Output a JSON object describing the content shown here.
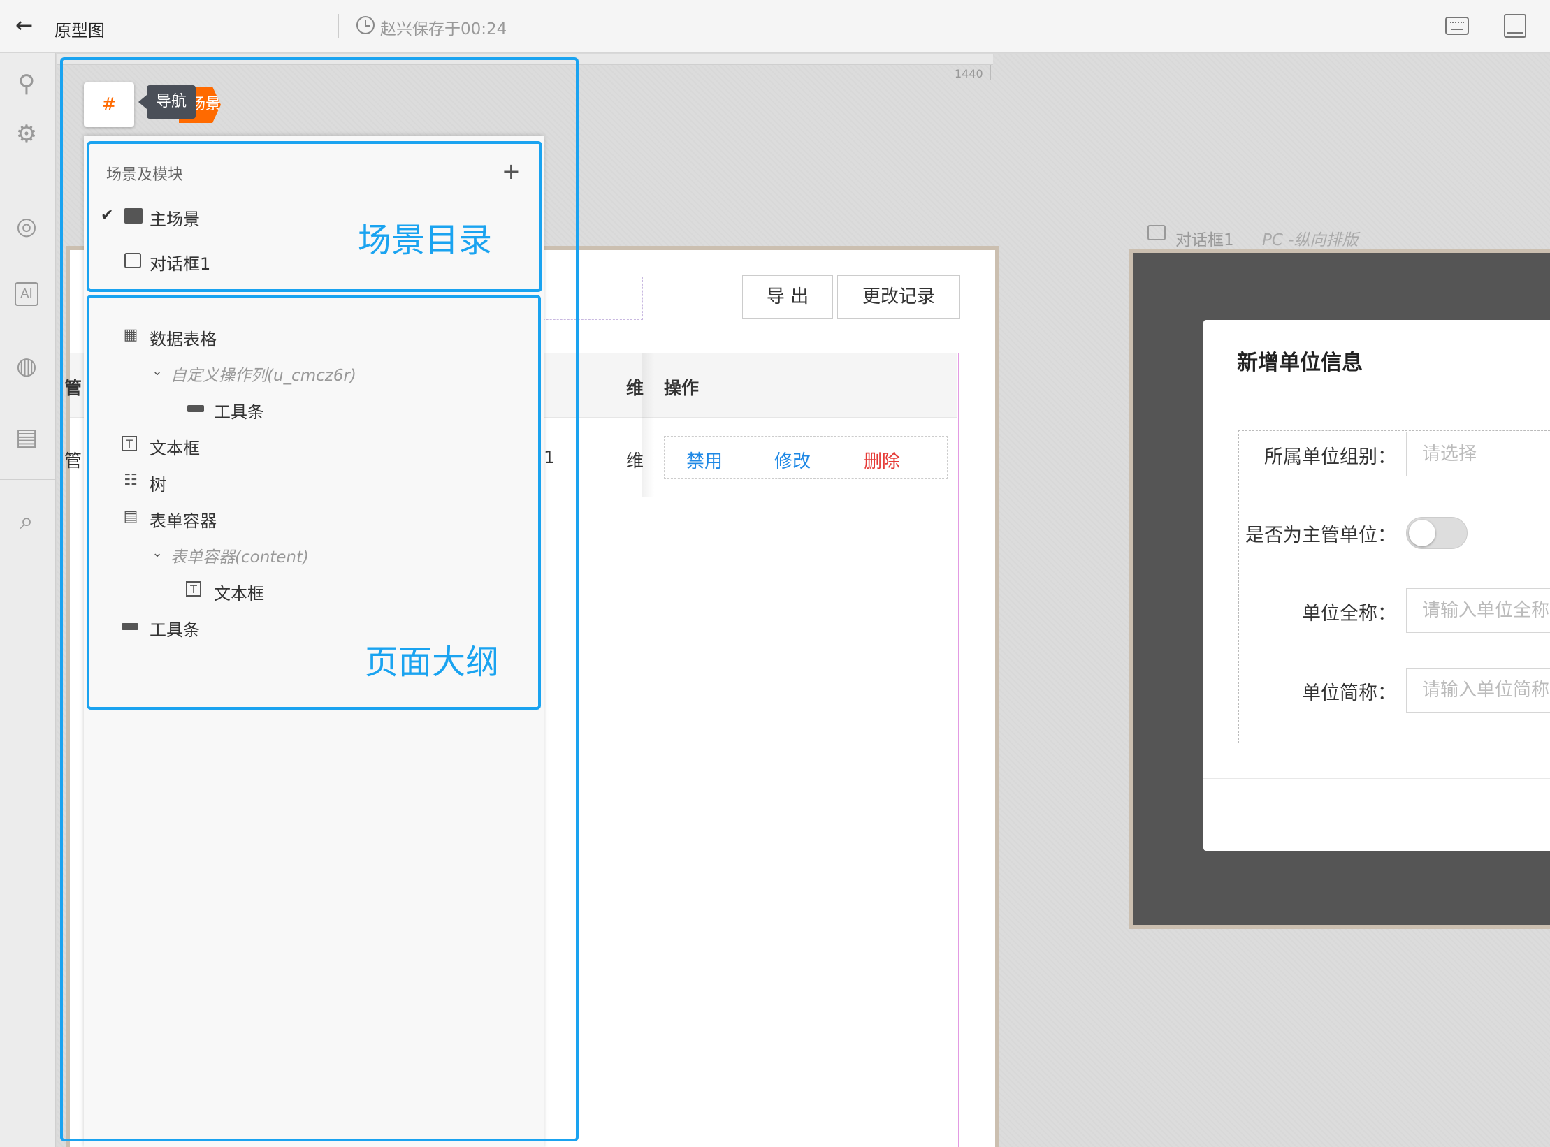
{
  "topbar": {
    "title": "原型图",
    "save_status": "赵兴保存于00:24"
  },
  "ruler": {
    "label": "1440"
  },
  "table": {
    "export_label": "导 出",
    "history_label": "更改记录",
    "header_cut_left": "管",
    "header_cut_mid": "",
    "header_maint": "维",
    "header_action": "操作",
    "row_cut_left": "管",
    "row_cut_mid": "1",
    "row_maint": "维",
    "actions": {
      "disable": "禁用",
      "edit": "修改",
      "delete": "删除"
    }
  },
  "dialog_scene": {
    "name": "对话框1",
    "layout": "PC -纵向排版",
    "title": "新增单位信息",
    "fields": {
      "org_label": "所属单位组别：",
      "org_placeholder": "请选择",
      "primary_label": "是否为主管单位：",
      "primary_value": false,
      "fullname_label": "单位全称：",
      "fullname_placeholder": "请输入单位全称",
      "shortname_label": "单位简称：",
      "shortname_placeholder": "请输入单位简称"
    }
  },
  "nav": {
    "hash_label": "#",
    "scene_tag": "场景",
    "tooltip": "导航",
    "scenes_header": "场景及模块",
    "scenes": [
      {
        "label": "主场景",
        "selected": true
      },
      {
        "label": "对话框1",
        "selected": false
      }
    ],
    "scenes_callout": "场景目录",
    "outline": [
      {
        "label": "数据表格",
        "icon": "table-icon"
      },
      {
        "label": "自定义操作列(u_cmcz6r)",
        "icon": "chevron-down-icon"
      },
      {
        "label": "工具条",
        "icon": "toolbar-icon"
      },
      {
        "label": "文本框",
        "icon": "textbox-icon"
      },
      {
        "label": "树",
        "icon": "tree-icon"
      },
      {
        "label": "表单容器",
        "icon": "form-container-icon"
      },
      {
        "label": "表单容器(content)",
        "icon": "chevron-down-icon"
      },
      {
        "label": "文本框",
        "icon": "textbox-icon"
      },
      {
        "label": "工具条",
        "icon": "toolbar-icon"
      }
    ],
    "outline_callout": "页面大纲"
  },
  "rail_icons": [
    "plugin-icon",
    "settings-icon",
    "globe-icon",
    "ai-chip-icon",
    "palette-icon",
    "history-icon",
    "search-icon"
  ],
  "colors": {
    "accent_blue": "#1aa3f0",
    "brand_orange": "#ff6a00",
    "link_blue": "#1e88e5",
    "danger_red": "#e53935"
  }
}
